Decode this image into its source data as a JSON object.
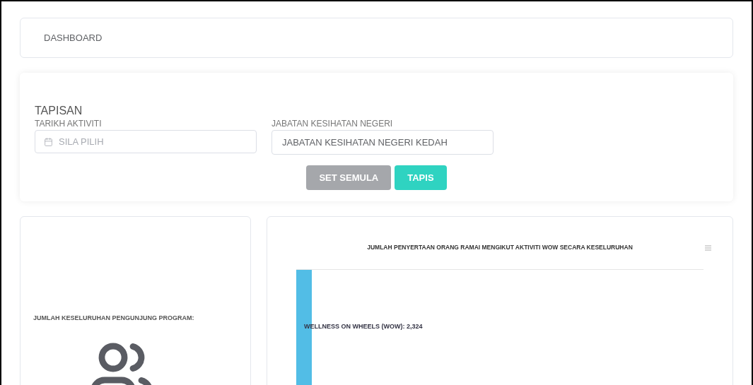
{
  "header": {
    "title": "DASHBOARD"
  },
  "filter": {
    "title": "TAPISAN",
    "fields": [
      {
        "label": "TARIKH AKTIVITI",
        "kind": "date",
        "placeholder": "SILA PILIH"
      },
      {
        "label": "JABATAN KESIHATAN NEGERI",
        "kind": "select",
        "value": "JABATAN KESIHATAN NEGERI KEDAH"
      }
    ],
    "buttons": [
      {
        "label": "SET SEMULA",
        "kind": "reset"
      },
      {
        "label": "TAPIS",
        "kind": "submit"
      }
    ]
  },
  "visitors_card": {
    "title": "JUMLAH KESELURUHAN PENGUNJUNG PROGRAM:"
  },
  "chart_card": {
    "title": "JUMLAH PENYERTAAN ORANG RAMAI MENGIKUT AKTIVITI WOW SECARA KESELURUHAN",
    "bar_label": "WELLNESS ON WHEELS (WOW): 2,324"
  }
}
